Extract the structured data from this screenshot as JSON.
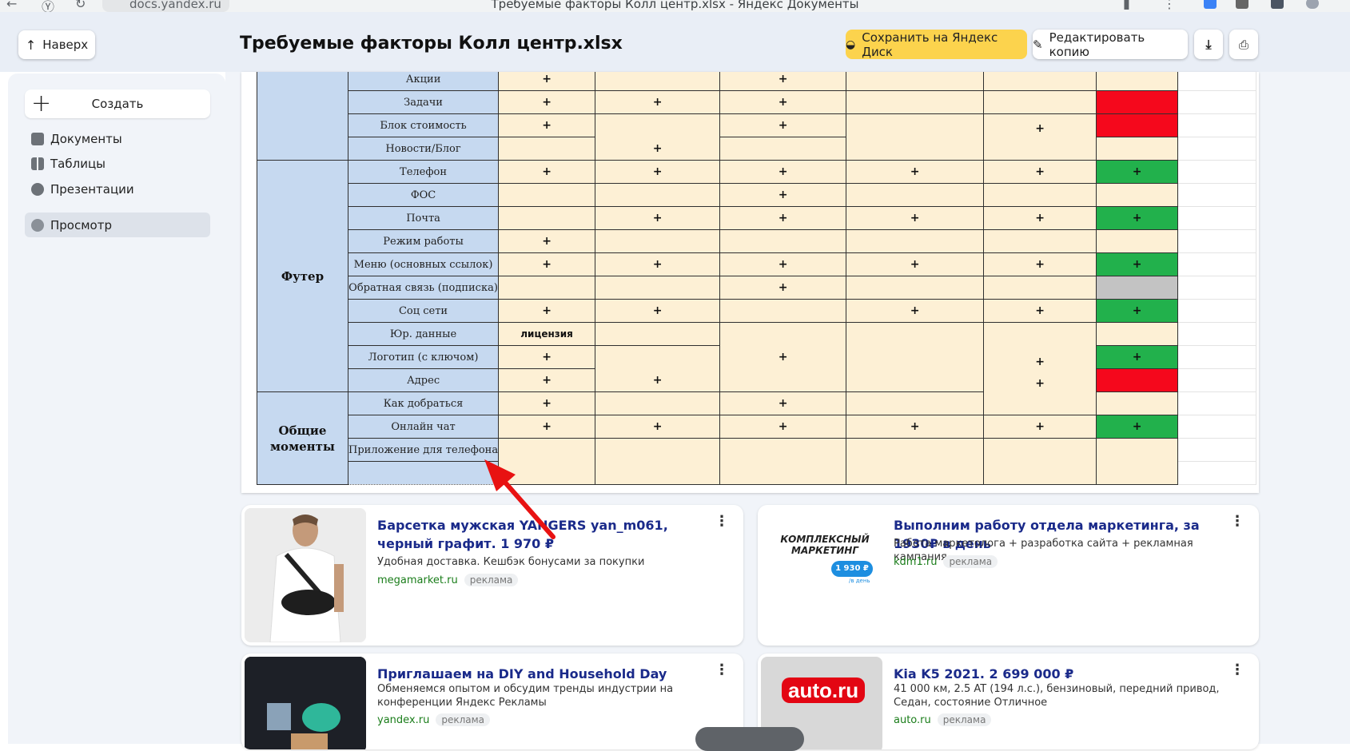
{
  "browser": {
    "url": "docs.yandex.ru",
    "window_title": "Требуемые факторы Колл центр.xlsx - Яндекс Документы"
  },
  "header": {
    "up_label": "Наверх",
    "doc_title": "Требуемые факторы Колл центр.xlsx",
    "save_label": "Сохранить на Яндекс Диск",
    "edit_label": "Редактировать копию",
    "icons": [
      "download-icon",
      "print-icon"
    ],
    "save_color": "#fcd34d"
  },
  "sidebar": {
    "create_label": "Создать",
    "items": [
      {
        "label": "Документы",
        "icon": "documents-icon"
      },
      {
        "label": "Таблицы",
        "icon": "tables-icon"
      },
      {
        "label": "Презентации",
        "icon": "presentations-icon"
      },
      {
        "label": "Просмотр",
        "icon": "view-icon",
        "active": true
      }
    ]
  },
  "sheet": {
    "groups": {
      "footer": "Футер",
      "general": "Общие моменты"
    },
    "rows": [
      "Акции",
      "Задачи",
      "Блок стоимость",
      "Новости/Блог",
      "Телефон",
      "ФОС",
      "Почта",
      "Режим работы",
      "Меню (основных ссылок)",
      "Обратная связь (подписка)",
      "Соц сети",
      "Юр. данные",
      "Логотип (с ключом)",
      "Адрес",
      "Как добраться",
      "Онлайн чат",
      "Приложение для телефона"
    ],
    "plus": "+",
    "license": "лицензия",
    "colors": {
      "header_blue": "#c6d9f0",
      "cream": "#fdf0d5",
      "red": "#f5081c",
      "green": "#22b14c",
      "gray": "#c3c3c3"
    }
  },
  "ads": [
    {
      "title": "Барсетка мужская YANGERS yan_m061, черный графит. 1 970 ₽",
      "desc": "Удобная доставка. Кешбэк бонусами за покупки",
      "domain": "megamarket.ru",
      "badge": "реклама"
    },
    {
      "title": "Выполним работу отдела маркетинга, за 1930₽ в день",
      "desc": "Работа маркетолога + разработка сайта + рекламная кампания.",
      "domain": "kdm1.ru",
      "badge": "реклама",
      "thumb_text": "КОМПЛЕКСНЫЙ МАРКЕТИНГ",
      "thumb_price": "1 930 ₽",
      "thumb_unit": "/в день"
    },
    {
      "title": "Приглашаем на DIY and Household Day",
      "desc": "Обменяемся опытом и обсудим тренды индустрии на конференции Яндекс Рекламы",
      "domain": "yandex.ru",
      "badge": "реклама"
    },
    {
      "title": "Kia K5 2021. 2 699 000 ₽",
      "desc": "41 000 км, 2.5 AT (194 л.с.), бензиновый, передний привод, Седан, состояние Отличное",
      "domain": "auto.ru",
      "badge": "реклама",
      "thumb_text": "auto.ru"
    }
  ]
}
